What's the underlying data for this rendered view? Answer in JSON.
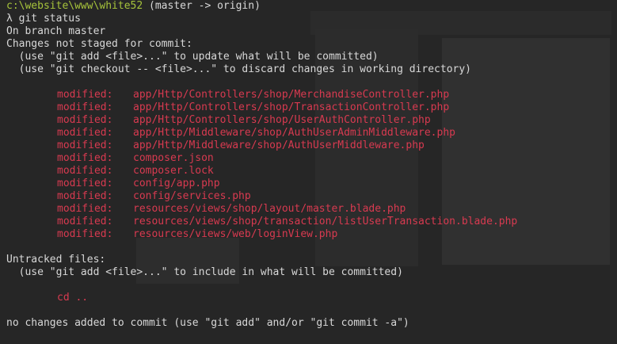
{
  "prompt": {
    "path": "c:\\website\\www\\white52",
    "branch_info": " (master -> origin)",
    "symbol": "λ",
    "command": " git status"
  },
  "status": {
    "on_branch": "On branch master",
    "changes_header": "Changes not staged for commit:",
    "hint_add": "  (use \"git add <file>...\" to update what will be committed)",
    "hint_checkout": "  (use \"git checkout -- <file>...\" to discard changes in working directory)",
    "modified_label": "modified:",
    "modified_files": [
      "app/Http/Controllers/shop/MerchandiseController.php",
      "app/Http/Controllers/shop/TransactionController.php",
      "app/Http/Controllers/shop/UserAuthController.php",
      "app/Http/Middleware/shop/AuthUserAdminMiddleware.php",
      "app/Http/Middleware/shop/AuthUserMiddleware.php",
      "composer.json",
      "composer.lock",
      "config/app.php",
      "config/services.php",
      "resources/views/shop/layout/master.blade.php",
      "resources/views/shop/transaction/listUserTransaction.blade.php",
      "resources/views/web/loginView.php"
    ],
    "untracked_header": "Untracked files:",
    "untracked_hint": "  (use \"git add <file>...\" to include in what will be committed)",
    "untracked_files": [
      "cd .."
    ],
    "footer": "no changes added to commit (use \"git add\" and/or \"git commit -a\")"
  },
  "colors": {
    "background": "#262626",
    "text": "#d8d8d8",
    "path": "#a6c33b",
    "modified": "#d83a50"
  }
}
